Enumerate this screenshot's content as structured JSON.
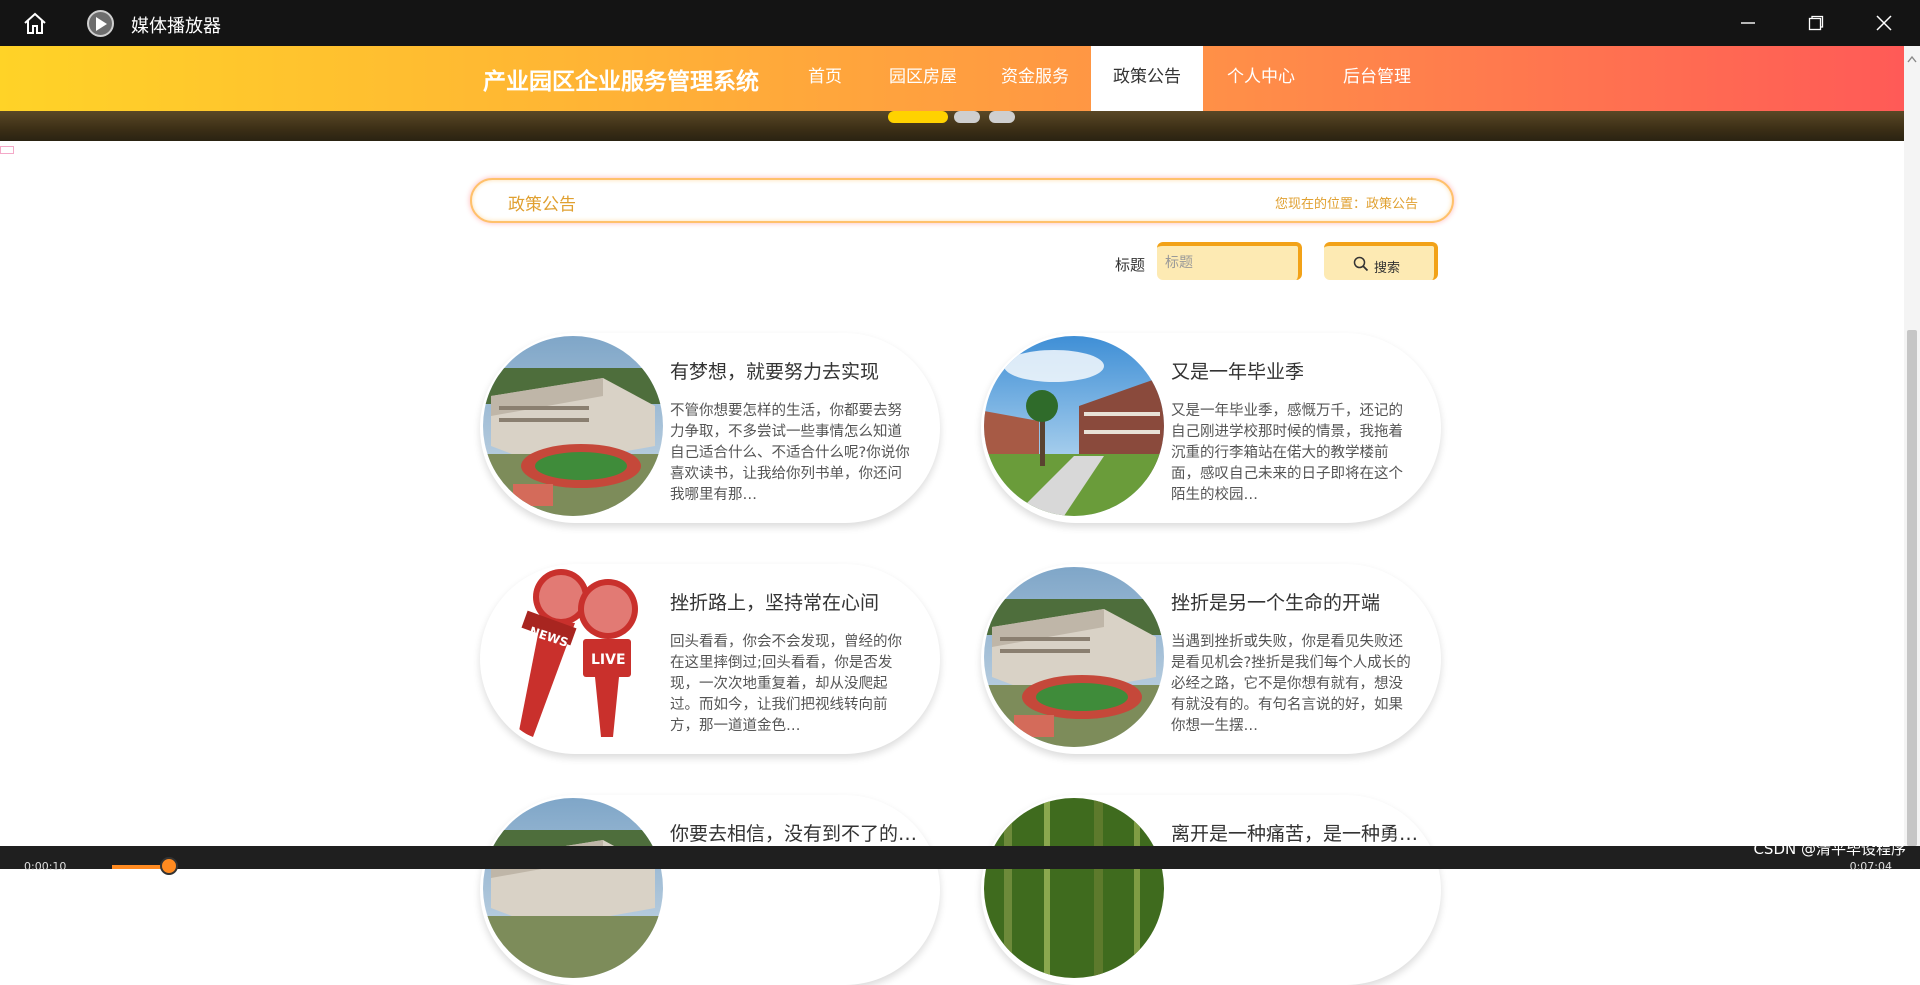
{
  "window": {
    "title": "媒体播放器",
    "buttons": [
      "minimize",
      "restore",
      "close"
    ]
  },
  "navbar": {
    "site_title": "产业园区企业服务管理系统",
    "items": [
      {
        "label": "首页",
        "active": false
      },
      {
        "label": "园区房屋",
        "active": false
      },
      {
        "label": "资金服务",
        "active": false
      },
      {
        "label": "政策公告",
        "active": true
      },
      {
        "label": "个人中心",
        "active": false
      },
      {
        "label": "后台管理",
        "active": false
      }
    ]
  },
  "banner": {
    "dots": 3,
    "active_dot": 0,
    "accent": "#ffd200"
  },
  "breadcrumb": {
    "title": "政策公告",
    "location": "您现在的位置：政策公告"
  },
  "search": {
    "label": "标题",
    "placeholder": "标题",
    "button_label": "搜索"
  },
  "cards": [
    {
      "title": "有梦想，就要努力去实现",
      "text": "不管你想要怎样的生活，你都要去努力争取，不多尝试一些事情怎么知道自己适合什么、不适合什么呢?你说你喜欢读书，让我给你列书单，你还问我哪里有那…",
      "image": "school-building"
    },
    {
      "title": "又是一年毕业季",
      "text": "又是一年毕业季，感慨万千，还记的自己刚进学校那时候的情景，我拖着沉重的行李箱站在偌大的教学楼前面，感叹自己未来的日子即将在这个陌生的校园…",
      "image": "campus-courtyard"
    },
    {
      "title": "挫折路上，坚持常在心间",
      "text": "回头看看，你会不会发现，曾经的你在这里摔倒过;回头看看，你是否发现，一次次地重复着，却从没爬起过。而如今，让我们把视线转向前方，那一道道金色…",
      "image": "news-live-microphones"
    },
    {
      "title": "挫折是另一个生命的开端",
      "text": "当遇到挫折或失败，你是看见失败还是看见机会?挫折是我们每个人成长的必经之路，它不是你想有就有，想没有就没有的。有句名言说的好，如果你想一生摆…",
      "image": "school-building"
    },
    {
      "title": "你要去相信，没有到不了的…",
      "text": "",
      "image": "school-building"
    },
    {
      "title": "离开是一种痛苦，是一种勇…",
      "text": "",
      "image": "forest"
    }
  ],
  "player": {
    "current_time": "0:00:10",
    "total_time": "0:07:04",
    "progress": 0.024
  },
  "watermark": "CSDN @清平毕设程序",
  "colors": {
    "accent": "#f2a218",
    "input_bg": "#fdeab3",
    "nav_start": "#ffd327",
    "nav_end": "#ff5a57"
  }
}
